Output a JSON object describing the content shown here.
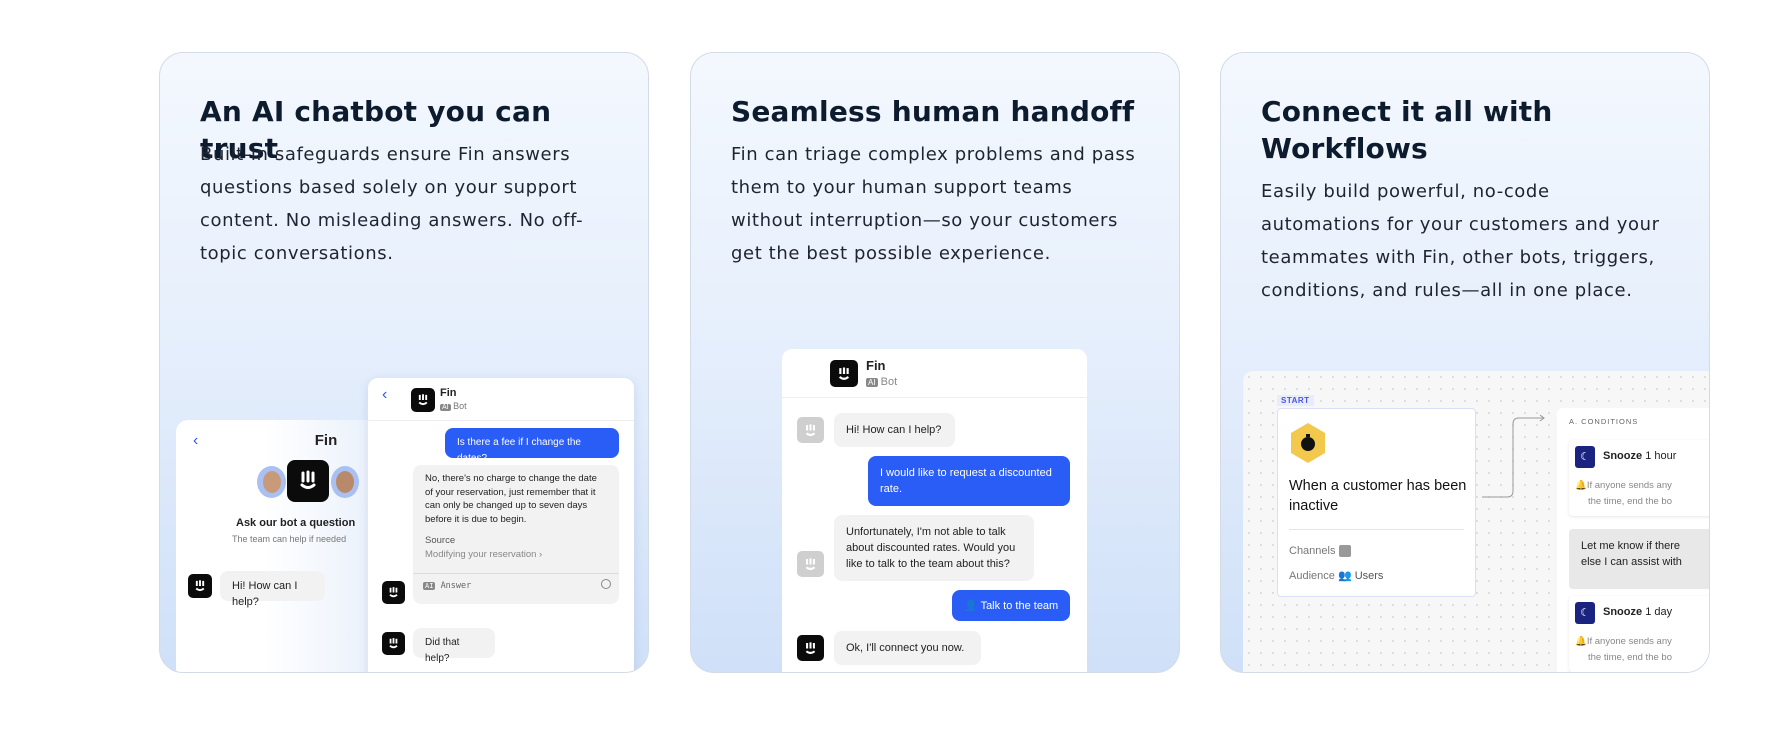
{
  "cards": [
    {
      "title": "An AI chatbot you can trust",
      "body": "Built-in safeguards ensure Fin answers questions based solely on your support content. No misleading answers. No off-topic conversations."
    },
    {
      "title": "Seamless human handoff",
      "body": "Fin can triage complex problems and pass them to your human support teams without interruption—so your customers get the best possible experience."
    },
    {
      "title": "Connect it all with Workflows",
      "body": "Easily build powerful, no-code automations for your customers and your teammates with Fin, other bots, triggers, conditions, and rules—all in one place."
    }
  ],
  "widget1": {
    "left": {
      "name": "Fin",
      "ask": "Ask our bot a question",
      "team": "The team can help if needed",
      "greeting": "Hi! How can I help?"
    },
    "right": {
      "name": "Fin",
      "ai": "AI",
      "role": "Bot",
      "question": "Is there a fee if I change the dates?",
      "answer": "No, there's no charge to change the date of your reservation, just remember that it can only be changed up to seven days before it is due to begin.",
      "source_label": "Source",
      "source_link": "Modifying your reservation",
      "answer_tag": "Answer",
      "followup": "Did that help?"
    }
  },
  "widget2": {
    "name": "Fin",
    "ai": "AI",
    "role": "Bot",
    "messages": [
      "Hi! How can I help?",
      "I would like to request a discounted rate.",
      "Unfortunately, I'm not able to talk about discounted rates. Would you like to talk to the team about this?",
      "Talk to the team",
      "Ok, I'll connect you now."
    ]
  },
  "workflow": {
    "start": "START",
    "trigger": "When a customer has been inactive",
    "channels": "Channels",
    "audience": "Audience",
    "users": "Users",
    "conditions": "A. CONDITIONS",
    "snooze1": "Snooze",
    "snooze1_dur": "1 hour",
    "cond_text": "If anyone sends any",
    "cond_text2": "the time, end the bo",
    "message": "Let me know if there",
    "message2": "else I can assist with",
    "snooze2": "Snooze",
    "snooze2_dur": "1 day"
  },
  "colors": {
    "accent": "#2a5cf6",
    "navy": "#0d1b2e",
    "snooze": "#1b2380",
    "trigger": "#f2c94c"
  }
}
